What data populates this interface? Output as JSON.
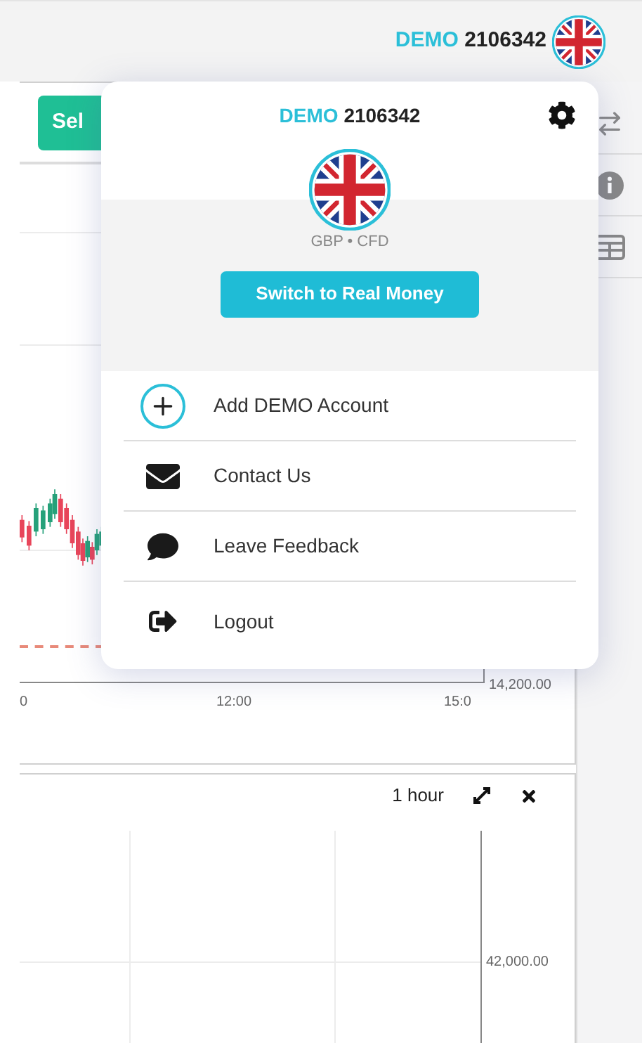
{
  "top_bar": {
    "account_type": "DEMO",
    "account_number": "2106342"
  },
  "trade_button": {
    "label": "Sel"
  },
  "chart": {
    "x_labels": [
      "0",
      "12:00",
      "15:0"
    ],
    "price_label": "14,200.00"
  },
  "chart_2": {
    "interval": "1 hour",
    "price_label": "42,000.00"
  },
  "account_menu": {
    "account_type": "DEMO",
    "account_number": "2106342",
    "currency": "GBP • CFD",
    "switch_button": "Switch to Real Money",
    "items": [
      {
        "kind": "add",
        "label": "Add DEMO Account"
      },
      {
        "kind": "contact",
        "label": "Contact Us"
      },
      {
        "kind": "feedback",
        "label": "Leave Feedback"
      },
      {
        "kind": "logout",
        "label": "Logout"
      }
    ]
  }
}
